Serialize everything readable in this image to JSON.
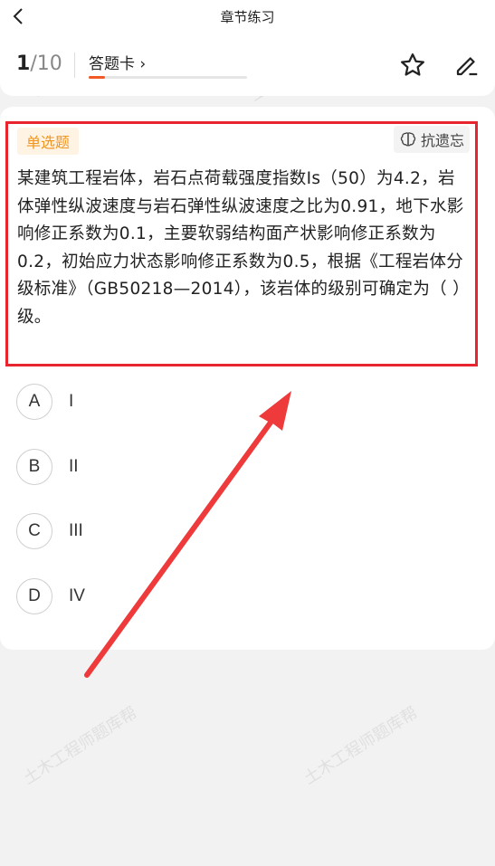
{
  "nav": {
    "title": "章节练习"
  },
  "header": {
    "current": "1",
    "total": "/10",
    "answer_card_label": "答题卡 ›",
    "progress": 0.1
  },
  "question": {
    "type_tag": "单选题",
    "anti_forget_label": "抗遗忘",
    "text": "某建筑工程岩体，岩石点荷载强度指数Is（50）为4.2，岩体弹性纵波速度与岩石弹性纵波速度之比为0.91，地下水影响修正系数为0.1，主要软弱结构面产状影响修正系数为0.2，初始应力状态影响修正系数为0.5，根据《工程岩体分级标准》（GB50218—2014），该岩体的级别可确定为（ ）级。"
  },
  "options": [
    {
      "letter": "A",
      "text": "I"
    },
    {
      "letter": "B",
      "text": "II"
    },
    {
      "letter": "C",
      "text": "III"
    },
    {
      "letter": "D",
      "text": "IV"
    }
  ],
  "watermark_text": "土木工程师题库帮",
  "colors": {
    "accent": "#f15a24",
    "highlight_border": "#e8242f",
    "tag_text": "#f0941f",
    "tag_bg": "#fff4e3"
  }
}
